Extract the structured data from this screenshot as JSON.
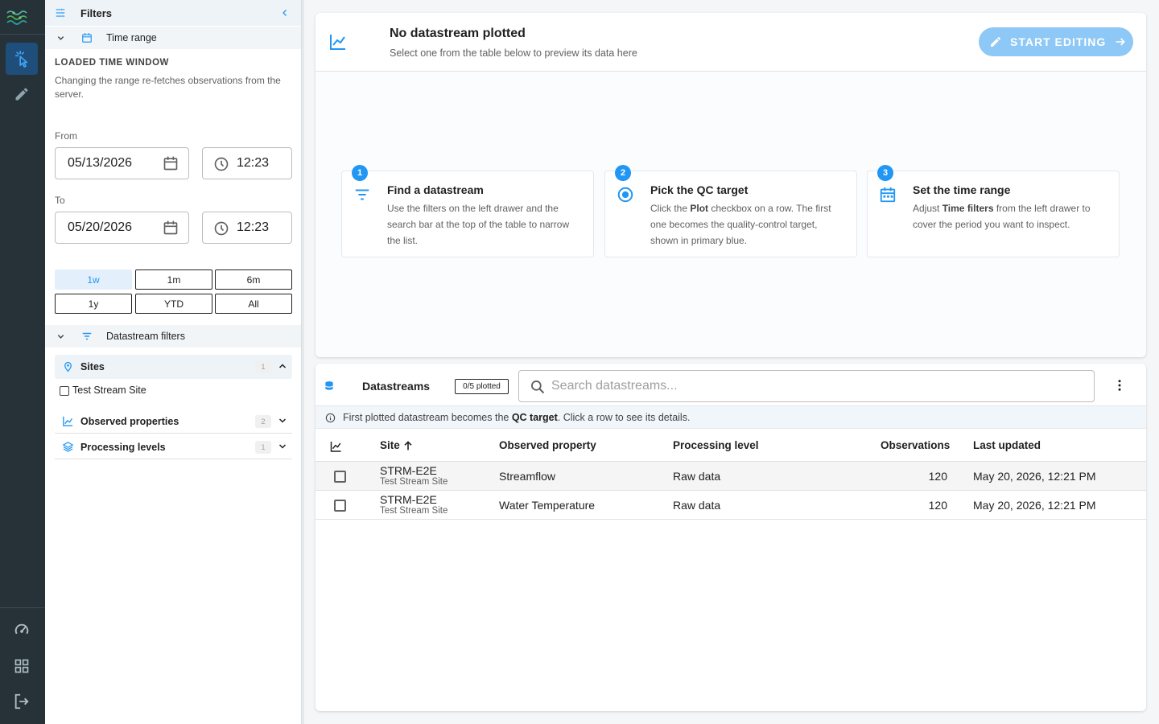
{
  "rail": {
    "items": [
      "logo",
      "select-tool",
      "edit-tool",
      "dashboard",
      "apps",
      "logout"
    ]
  },
  "drawer": {
    "title": "Filters",
    "time_section": {
      "title": "Time range",
      "overline": "LOADED TIME WINDOW",
      "hint": "Changing the range re-fetches observations from the server.",
      "from_label": "From",
      "from_date": "05/13/2026",
      "from_time": "12:23",
      "to_label": "To",
      "to_date": "05/20/2026",
      "to_time": "12:23",
      "presets": [
        "1w",
        "1m",
        "6m",
        "1y",
        "YTD",
        "All"
      ],
      "active_preset": "1w"
    },
    "datastream_section": {
      "title": "Datastream filters",
      "sites": {
        "label": "Sites",
        "count": "1",
        "options": [
          "Test Stream Site"
        ]
      },
      "observed": {
        "label": "Observed properties",
        "count": "2"
      },
      "levels": {
        "label": "Processing levels",
        "count": "1"
      }
    }
  },
  "plot": {
    "title": "No datastream plotted",
    "subtitle": "Select one from the table below to preview its data here",
    "start_button": "START EDITING",
    "steps": [
      {
        "num": "1",
        "title": "Find a datastream",
        "desc": "Use the filters on the left drawer and the search bar at the top of the table to narrow the list."
      },
      {
        "num": "2",
        "title": "Pick the QC target",
        "desc_pre": "Click the ",
        "desc_bold": "Plot",
        "desc_post": " checkbox on a row. The first one becomes the quality-control target, shown in primary blue."
      },
      {
        "num": "3",
        "title": "Set the time range",
        "desc_pre": "Adjust ",
        "desc_bold": "Time filters",
        "desc_post": " from the left drawer to cover the period you want to inspect."
      }
    ]
  },
  "table": {
    "title": "Datastreams",
    "plotted_chip": "0/5 plotted",
    "search_placeholder": "Search datastreams...",
    "info_pre": "First plotted datastream becomes the ",
    "info_bold": "QC target",
    "info_post": ". Click a row to see its details.",
    "columns": {
      "site": "Site",
      "observed": "Observed property",
      "level": "Processing level",
      "obs": "Observations",
      "updated": "Last updated"
    },
    "rows": [
      {
        "site_code": "STRM-E2E",
        "site_name": "Test Stream Site",
        "observed": "Streamflow",
        "level": "Raw data",
        "obs": "120",
        "updated": "May 20, 2026, 12:21 PM"
      },
      {
        "site_code": "STRM-E2E",
        "site_name": "Test Stream Site",
        "observed": "Water Temperature",
        "level": "Raw data",
        "obs": "120",
        "updated": "May 20, 2026, 12:21 PM"
      }
    ]
  },
  "colors": {
    "primary": "#2196f3",
    "rail": "#263238",
    "start_button": "#8ec8f6"
  }
}
